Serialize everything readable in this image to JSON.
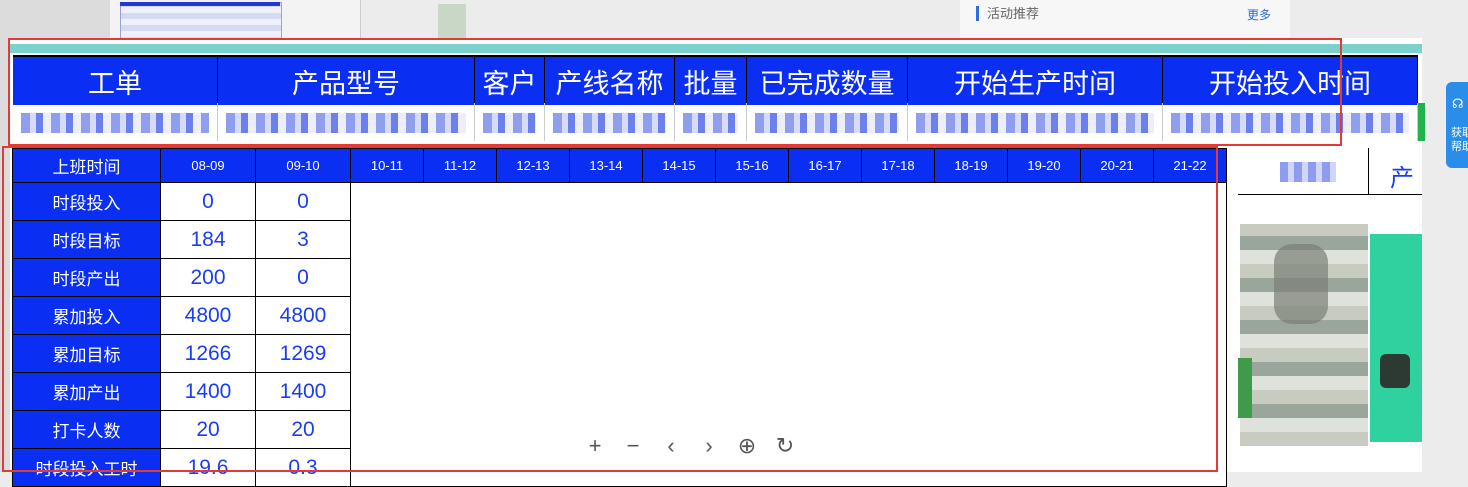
{
  "background": {
    "panel_title": "活动推荐",
    "panel_more": "更多",
    "help_text_1": "获取",
    "help_text_2": "帮助"
  },
  "top_table": {
    "headers": [
      "工单",
      "产品型号",
      "客户",
      "产线名称",
      "批量",
      "已完成数量",
      "开始生产时间",
      "开始投入时间"
    ]
  },
  "hourly_table": {
    "corner_label": "上班时间",
    "hours": [
      "08-09",
      "09-10",
      "10-11",
      "11-12",
      "12-13",
      "13-14",
      "14-15",
      "15-16",
      "16-17",
      "17-18",
      "18-19",
      "19-20",
      "20-21",
      "21-22"
    ],
    "rows": [
      {
        "label": "时段投入",
        "values": [
          "0",
          "0"
        ]
      },
      {
        "label": "时段目标",
        "values": [
          "184",
          "3"
        ]
      },
      {
        "label": "时段产出",
        "values": [
          "200",
          "0"
        ]
      },
      {
        "label": "累加投入",
        "values": [
          "4800",
          "4800"
        ]
      },
      {
        "label": "累加目标",
        "values": [
          "1266",
          "1269"
        ]
      },
      {
        "label": "累加产出",
        "values": [
          "1400",
          "1400"
        ]
      },
      {
        "label": "打卡人数",
        "values": [
          "20",
          "20"
        ]
      },
      {
        "label": "时段投入工时",
        "values": [
          "19.6",
          "0.3"
        ]
      }
    ]
  },
  "photo_panel": {
    "header_partial": "产"
  },
  "viewer_toolbar": {
    "zoom_in": "+",
    "zoom_out": "−",
    "prev": "‹",
    "next": "›",
    "fit": "⊕",
    "rotate": "↻"
  },
  "colors": {
    "header_blue": "#0a2ef2",
    "value_blue": "#1a3df2",
    "teal_strip": "#7dd1cc",
    "annotation_red": "#e53935"
  }
}
